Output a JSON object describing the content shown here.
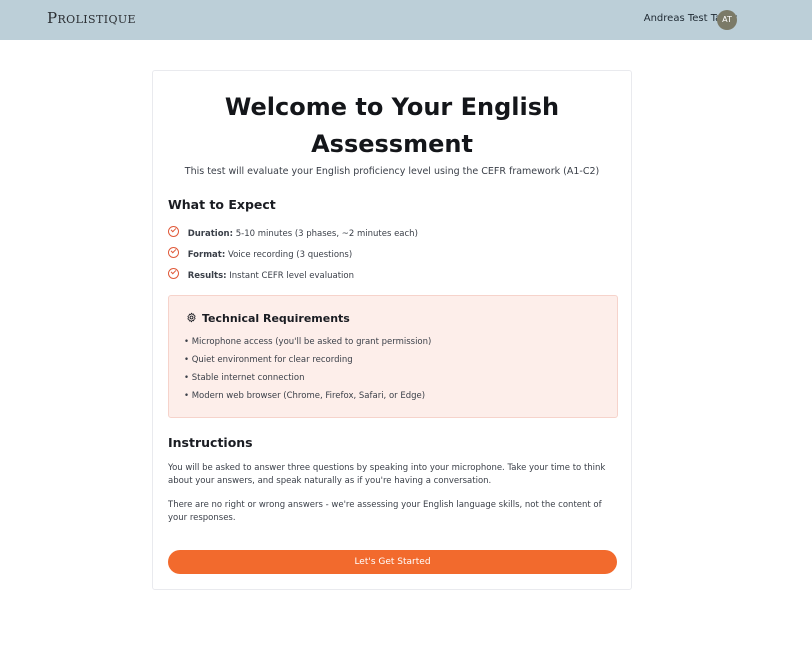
{
  "header": {
    "logo": "Prolistique",
    "user_name": "Andreas Test Taker",
    "avatar_initials": "AT"
  },
  "card": {
    "title_line1": "Welcome to Your English",
    "title_line2": "Assessment",
    "subtitle": "This test will evaluate your English proficiency level using the CEFR framework (A1-C2)"
  },
  "expect": {
    "heading": "What to Expect",
    "items": [
      {
        "label": "Duration:",
        "text": "5-10 minutes (3 phases, ~2 minutes each)"
      },
      {
        "label": "Format:",
        "text": "Voice recording (3 questions)"
      },
      {
        "label": "Results:",
        "text": "Instant CEFR level evaluation"
      }
    ]
  },
  "tech": {
    "heading": "Technical Requirements",
    "items": [
      "• Microphone access (you'll be asked to grant permission)",
      "• Quiet environment for clear recording",
      "• Stable internet connection",
      "• Modern web browser (Chrome, Firefox, Safari, or Edge)"
    ]
  },
  "instructions": {
    "heading": "Instructions",
    "paragraph1": "You will be asked to answer three questions by speaking into your microphone. Take your time to think about your answers, and speak naturally as if you're having a conversation.",
    "paragraph2": "There are no right or wrong answers - we're assessing your English language skills, not the content of your responses."
  },
  "cta": {
    "label": "Let's Get Started"
  },
  "colors": {
    "header_bg": "#bccfd8",
    "accent": "#f26a2d",
    "tech_bg": "#fdeeea"
  },
  "icons": {
    "check": "check-circle-icon",
    "gear": "gear-icon"
  }
}
